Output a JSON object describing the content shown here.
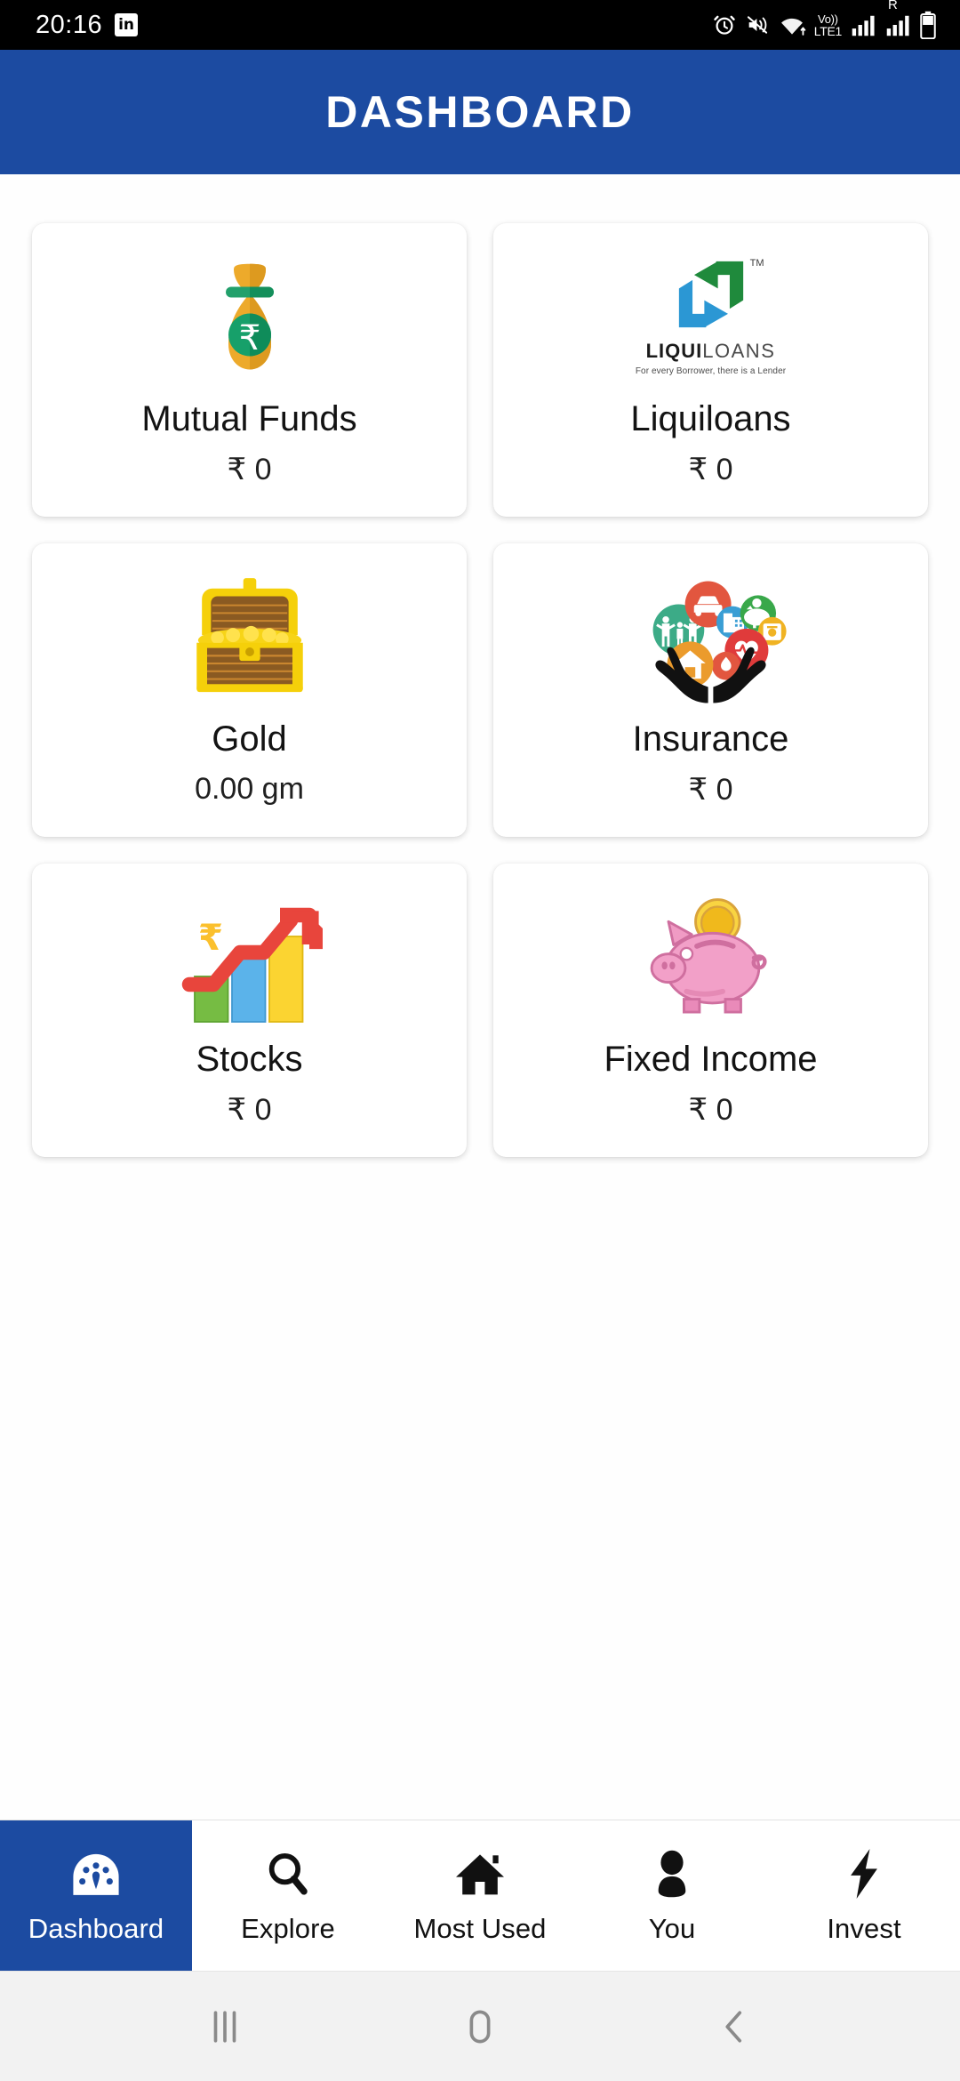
{
  "status_bar": {
    "time": "20:16",
    "app_icon": "in",
    "icons": [
      "alarm-icon",
      "mute-vibrate-icon",
      "wifi-icon",
      "volte-icon",
      "signal-icon",
      "roaming-icon",
      "battery-icon"
    ],
    "volte_top": "Vo))",
    "volte_bottom": "LTE1",
    "roaming_letter": "R"
  },
  "header": {
    "title": "DASHBOARD",
    "bg_color": "#1c4ba1",
    "text_color": "#ffffff"
  },
  "cards": [
    {
      "id": "mutual-funds",
      "icon": "money-bag-icon",
      "label": "Mutual Funds",
      "value": "₹ 0"
    },
    {
      "id": "liquiloans",
      "icon": "liquiloans-logo",
      "label": "Liquiloans",
      "value": "₹ 0",
      "logo_name_bold": "LIQUI",
      "logo_name_light": "LOANS",
      "logo_tm": "TM",
      "logo_tagline": "For every Borrower, there is a Lender"
    },
    {
      "id": "gold",
      "icon": "treasure-chest-icon",
      "label": "Gold",
      "value": "0.00 gm"
    },
    {
      "id": "insurance",
      "icon": "insurance-hands-icon",
      "label": "Insurance",
      "value": "₹ 0"
    },
    {
      "id": "stocks",
      "icon": "growth-chart-icon",
      "label": "Stocks",
      "value": "₹ 0"
    },
    {
      "id": "fixed-income",
      "icon": "piggy-bank-icon",
      "label": "Fixed Income",
      "value": "₹ 0"
    }
  ],
  "bottom_nav": {
    "active_index": 0,
    "active_bg": "#1c4ba1",
    "items": [
      {
        "id": "dashboard",
        "label": "Dashboard",
        "icon": "speedometer-icon",
        "active": true
      },
      {
        "id": "explore",
        "label": "Explore",
        "icon": "search-icon",
        "active": false
      },
      {
        "id": "most-used",
        "label": "Most Used",
        "icon": "home-icon",
        "active": false
      },
      {
        "id": "you",
        "label": "You",
        "icon": "person-icon",
        "active": false
      },
      {
        "id": "invest",
        "label": "Invest",
        "icon": "lightning-bolt-icon",
        "active": false
      }
    ]
  },
  "android_nav": {
    "items": [
      {
        "id": "recents",
        "icon": "recents-icon"
      },
      {
        "id": "home",
        "icon": "home-pill-icon"
      },
      {
        "id": "back",
        "icon": "back-chevron-icon"
      }
    ]
  }
}
